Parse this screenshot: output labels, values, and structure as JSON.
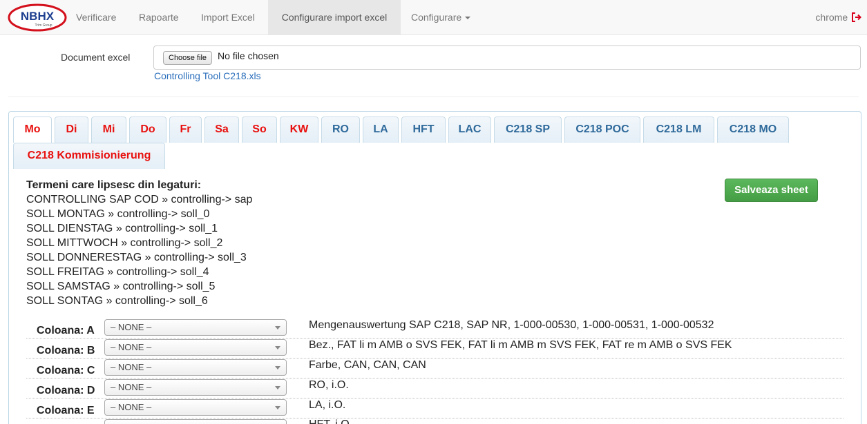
{
  "navbar": {
    "logo_text": "NBHX",
    "logo_subtext": "Trim Group",
    "items": [
      {
        "label": "Verificare"
      },
      {
        "label": "Rapoarte"
      },
      {
        "label": "Import Excel"
      },
      {
        "label": "Configurare import excel",
        "active": true
      },
      {
        "label": "Configurare",
        "dropdown": true
      }
    ],
    "user": "chrome",
    "logout_icon": "sign-out-icon"
  },
  "file": {
    "label": "Document excel",
    "button_label": "Choose file",
    "status": "No file chosen",
    "current_file": "Controlling Tool C218.xls"
  },
  "tabs": [
    {
      "label": "Mo",
      "color": "red",
      "active": true
    },
    {
      "label": "Di",
      "color": "red"
    },
    {
      "label": "Mi",
      "color": "red"
    },
    {
      "label": "Do",
      "color": "red"
    },
    {
      "label": "Fr",
      "color": "red"
    },
    {
      "label": "Sa",
      "color": "red"
    },
    {
      "label": "So",
      "color": "red"
    },
    {
      "label": "KW",
      "color": "red"
    },
    {
      "label": "RO",
      "color": "blue"
    },
    {
      "label": "LA",
      "color": "blue"
    },
    {
      "label": "HFT",
      "color": "blue"
    },
    {
      "label": "LAC",
      "color": "blue"
    },
    {
      "label": "C218 SP",
      "color": "blue"
    },
    {
      "label": "C218 POC",
      "color": "blue"
    },
    {
      "label": "C218 LM",
      "color": "blue"
    },
    {
      "label": "C218 MO",
      "color": "blue"
    },
    {
      "label": "C218 Kommisionierung",
      "color": "red"
    }
  ],
  "missing": {
    "title": "Termeni care lipsesc din legaturi:",
    "lines": [
      "CONTROLLING SAP COD » controlling-> sap",
      "SOLL MONTAG » controlling-> soll_0",
      "SOLL DIENSTAG » controlling-> soll_1",
      "SOLL MITTWOCH » controlling-> soll_2",
      "SOLL DONNERESTAG » controlling-> soll_3",
      "SOLL FREITAG » controlling-> soll_4",
      "SOLL SAMSTAG » controlling-> soll_5",
      "SOLL SONTAG » controlling-> soll_6"
    ]
  },
  "save_button": "Salveaza sheet",
  "columns": [
    {
      "label": "Coloana: A",
      "selected": "– NONE –",
      "values": "Mengenauswertung SAP C218, SAP NR, 1-000-00530, 1-000-00531, 1-000-00532"
    },
    {
      "label": "Coloana: B",
      "selected": "– NONE –",
      "values": "Bez., FAT li m AMB o SVS FEK, FAT li m AMB m SVS FEK, FAT re m AMB o SVS FEK"
    },
    {
      "label": "Coloana: C",
      "selected": "– NONE –",
      "values": "Farbe, CAN, CAN, CAN"
    },
    {
      "label": "Coloana: D",
      "selected": "– NONE –",
      "values": "RO, i.O."
    },
    {
      "label": "Coloana: E",
      "selected": "– NONE –",
      "values": "LA, i.O."
    },
    {
      "label": "",
      "selected": "",
      "values": "HFT, i.O."
    }
  ],
  "colors": {
    "brand_red": "#d3101c",
    "tab_red": "#e8110f",
    "tab_blue": "#2f6a9b",
    "link_blue": "#2a6ebb",
    "save_green": "#5cb85c"
  }
}
